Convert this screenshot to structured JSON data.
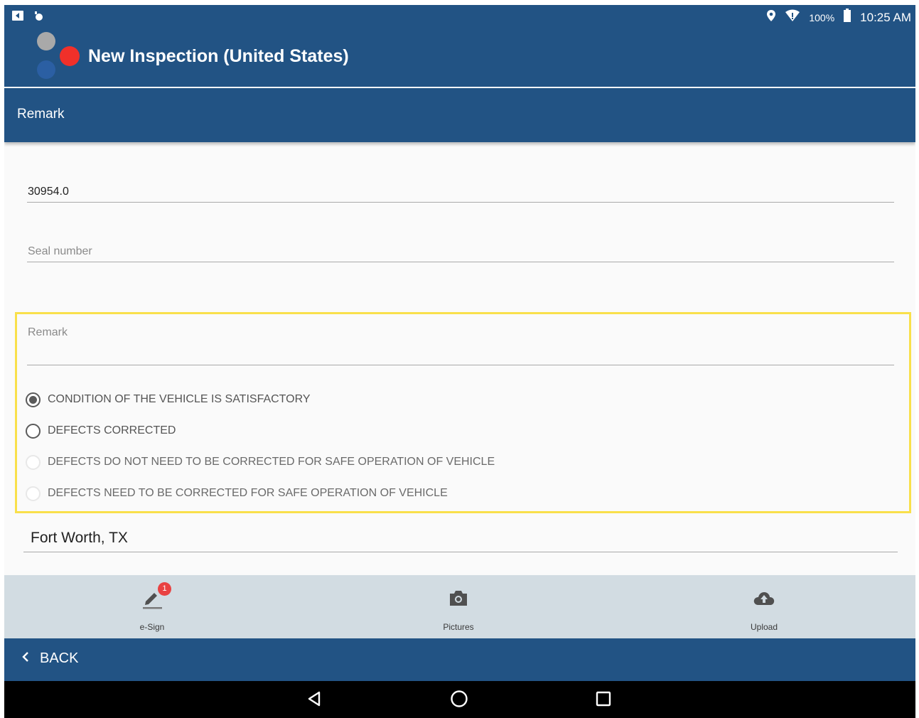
{
  "status_bar": {
    "battery_percent": "100%",
    "time": "10:25 AM",
    "icons": [
      "screenshot-icon",
      "notification-icon",
      "location-pin-icon",
      "wifi-icon",
      "battery-icon"
    ]
  },
  "app_bar": {
    "title": "New Inspection (United States)",
    "logo_colors": {
      "grey": "#a9a9a9",
      "red": "#f0302a",
      "blue": "#2b5fa3"
    }
  },
  "section": {
    "title": "Remark"
  },
  "form": {
    "odometer_value": "30954.0",
    "seal_number_placeholder": "Seal number",
    "remark_placeholder": "Remark",
    "condition_options": [
      {
        "label": "CONDITION OF THE VEHICLE IS SATISFACTORY",
        "checked": true,
        "enabled": true
      },
      {
        "label": "DEFECTS CORRECTED",
        "checked": false,
        "enabled": true
      },
      {
        "label": "DEFECTS DO NOT NEED TO BE CORRECTED FOR SAFE OPERATION OF VEHICLE",
        "checked": false,
        "enabled": false
      },
      {
        "label": "DEFECTS NEED TO BE CORRECTED FOR SAFE OPERATION OF VEHICLE",
        "checked": false,
        "enabled": false
      }
    ],
    "location_value": "Fort Worth, TX"
  },
  "actions": {
    "esign_label": "e-Sign",
    "esign_badge": "1",
    "pictures_label": "Pictures",
    "upload_label": "Upload"
  },
  "back_bar": {
    "label": "BACK"
  },
  "colors": {
    "primary": "#225384",
    "highlight": "#f9e04b",
    "action_bar": "#d2dce2",
    "badge": "#e94242"
  }
}
